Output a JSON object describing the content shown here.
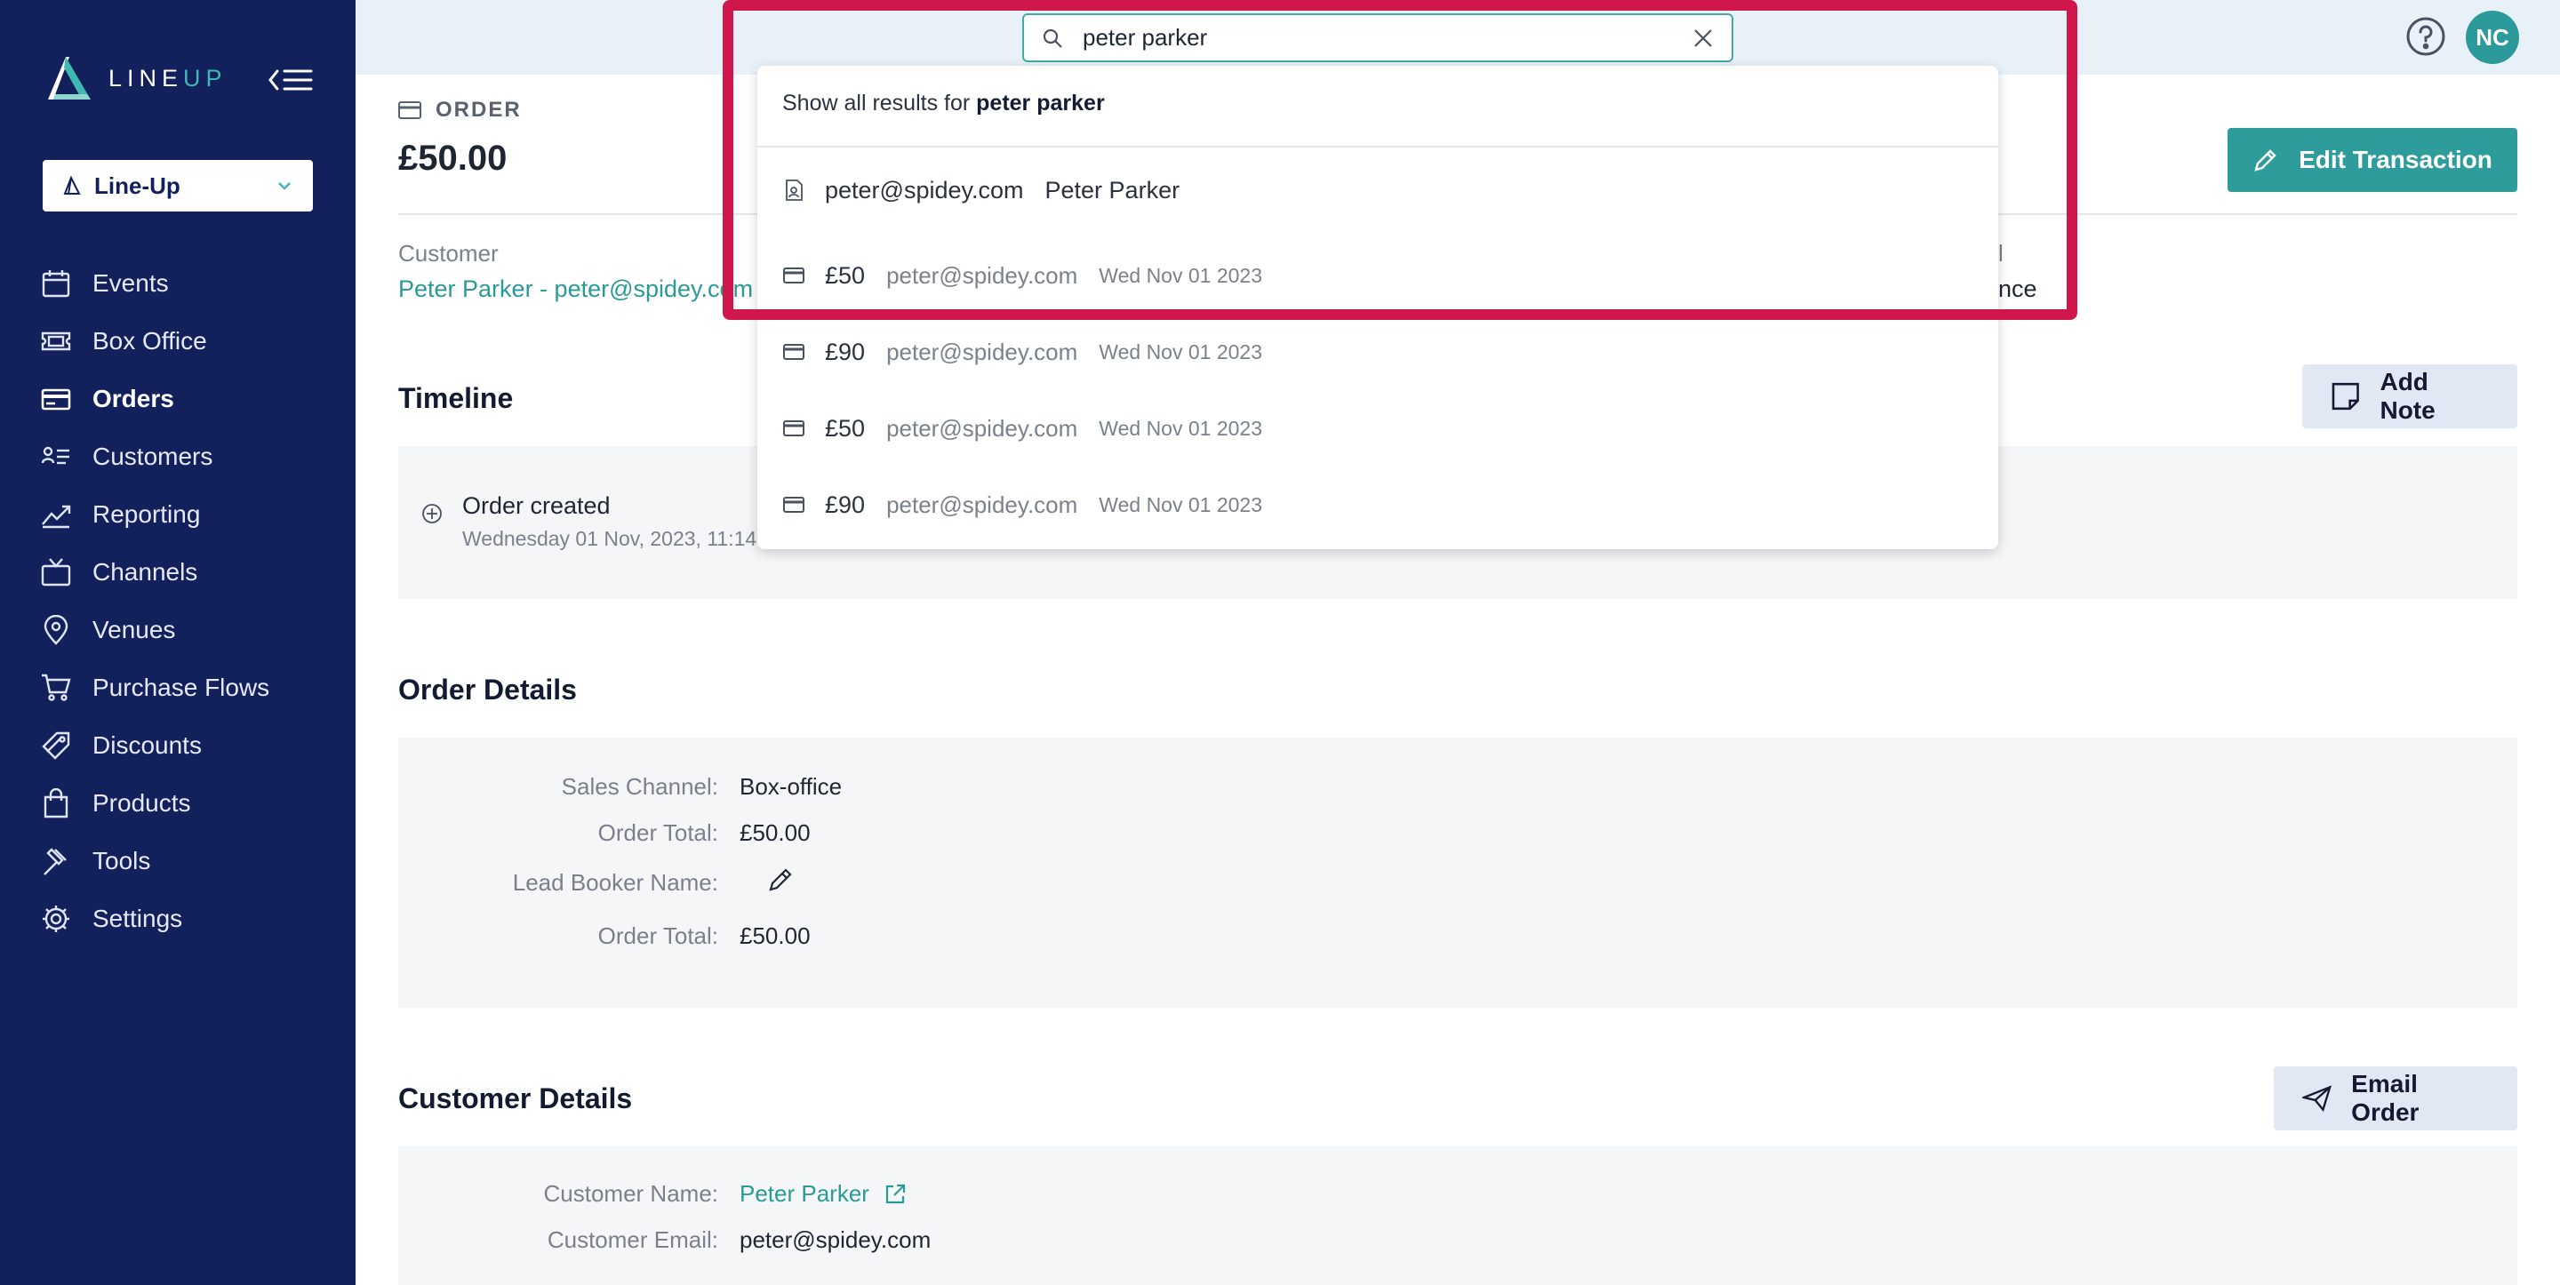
{
  "sidebar": {
    "logo_line": "LINE",
    "logo_up": "UP",
    "org_selector": "Line-Up",
    "items": [
      {
        "label": "Events",
        "icon": "calendar-icon"
      },
      {
        "label": "Box Office",
        "icon": "ticket-icon"
      },
      {
        "label": "Orders",
        "icon": "credit-card-icon",
        "active": true
      },
      {
        "label": "Customers",
        "icon": "customers-icon"
      },
      {
        "label": "Reporting",
        "icon": "chart-icon"
      },
      {
        "label": "Channels",
        "icon": "tv-icon"
      },
      {
        "label": "Venues",
        "icon": "map-pin-icon"
      },
      {
        "label": "Purchase Flows",
        "icon": "cart-icon"
      },
      {
        "label": "Discounts",
        "icon": "tag-icon"
      },
      {
        "label": "Products",
        "icon": "bag-icon"
      },
      {
        "label": "Tools",
        "icon": "hammer-icon"
      },
      {
        "label": "Settings",
        "icon": "gear-icon"
      }
    ]
  },
  "header": {
    "avatar_initials": "NC",
    "search_value": "peter parker"
  },
  "search_results": {
    "show_all_prefix": "Show all results for",
    "show_all_query": "peter parker",
    "customer": {
      "email": "peter@spidey.com",
      "name": "Peter Parker"
    },
    "orders": [
      {
        "amount": "£50",
        "email": "peter@spidey.com",
        "date": "Wed Nov 01 2023"
      },
      {
        "amount": "£90",
        "email": "peter@spidey.com",
        "date": "Wed Nov 01 2023"
      },
      {
        "amount": "£50",
        "email": "peter@spidey.com",
        "date": "Wed Nov 01 2023"
      },
      {
        "amount": "£90",
        "email": "peter@spidey.com",
        "date": "Wed Nov 01 2023"
      }
    ]
  },
  "order": {
    "kicker": "ORDER",
    "amount": "£50.00",
    "edit_label": "Edit Transaction",
    "customer_label": "Customer",
    "customer_link": "Peter Parker - peter@spidey.com",
    "right_stub_label": "l",
    "right_stub_value": "nce"
  },
  "timeline": {
    "title": "Timeline",
    "add_note_label": "Add Note",
    "event_title": "Order created",
    "event_time": "Wednesday 01 Nov, 2023, 11:14"
  },
  "order_details": {
    "title": "Order Details",
    "rows": [
      {
        "k": "Sales Channel:",
        "v": "Box-office"
      },
      {
        "k": "Order Total:",
        "v": "£50.00"
      },
      {
        "k": "Lead Booker Name:",
        "v": ""
      },
      {
        "k": "Order Total:",
        "v": "£50.00"
      }
    ]
  },
  "customer_details": {
    "title": "Customer Details",
    "email_order_label": "Email Order",
    "name_label": "Customer Name:",
    "name_value": "Peter Parker",
    "email_label": "Customer Email:",
    "email_value": "peter@spidey.com"
  }
}
